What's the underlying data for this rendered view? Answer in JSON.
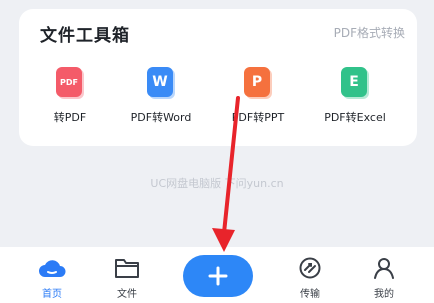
{
  "toolbox": {
    "title": "文件工具箱",
    "link": "PDF格式转换",
    "tools": [
      {
        "label": "转PDF",
        "glyph": "PDF",
        "color": "#f45b69",
        "icon": "pdf-icon"
      },
      {
        "label": "PDF转Word",
        "glyph": "W",
        "color": "#3a8bf6",
        "icon": "word-icon"
      },
      {
        "label": "PDF转PPT",
        "glyph": "P",
        "color": "#f5713e",
        "icon": "ppt-icon"
      },
      {
        "label": "PDF转Excel",
        "glyph": "E",
        "color": "#31c28a",
        "icon": "excel-icon"
      }
    ]
  },
  "watermark": "UC网盘电脑版   下问yun.cn",
  "tabbar": {
    "home": "首页",
    "files": "文件",
    "transfer": "传输",
    "mine": "我的"
  },
  "colors": {
    "accent": "#2b7bf6",
    "plus_button": "#2d87f7",
    "annotation_arrow": "#e8242b"
  }
}
